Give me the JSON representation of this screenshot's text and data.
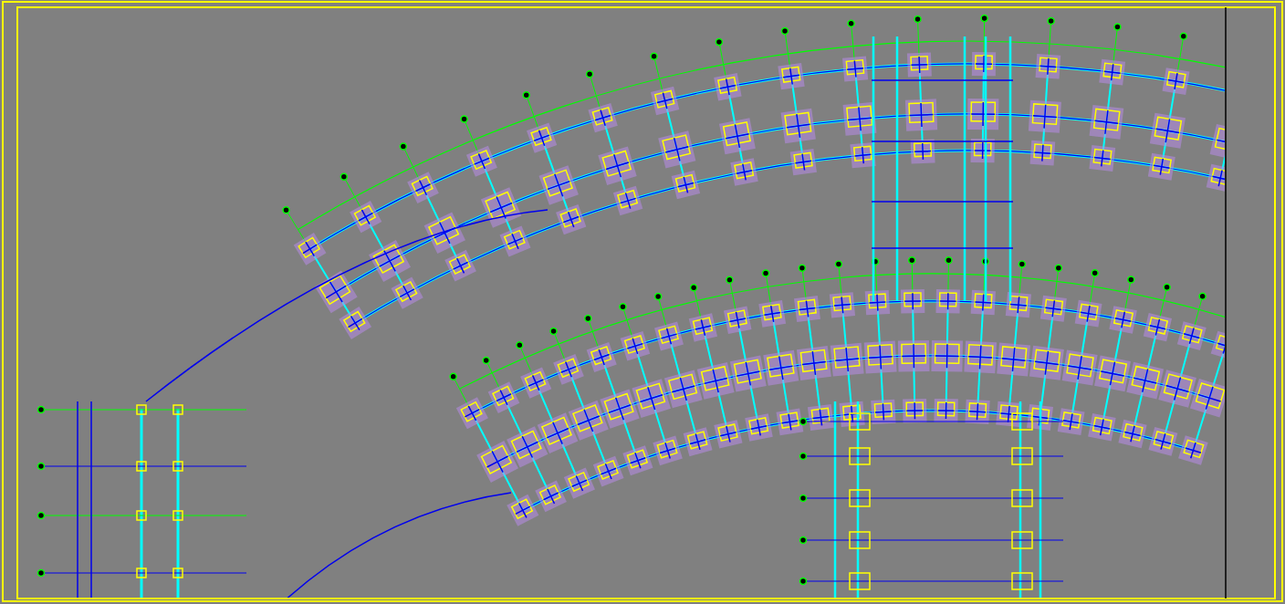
{
  "drawing": {
    "kind": "radial-column-plan"
  }
}
